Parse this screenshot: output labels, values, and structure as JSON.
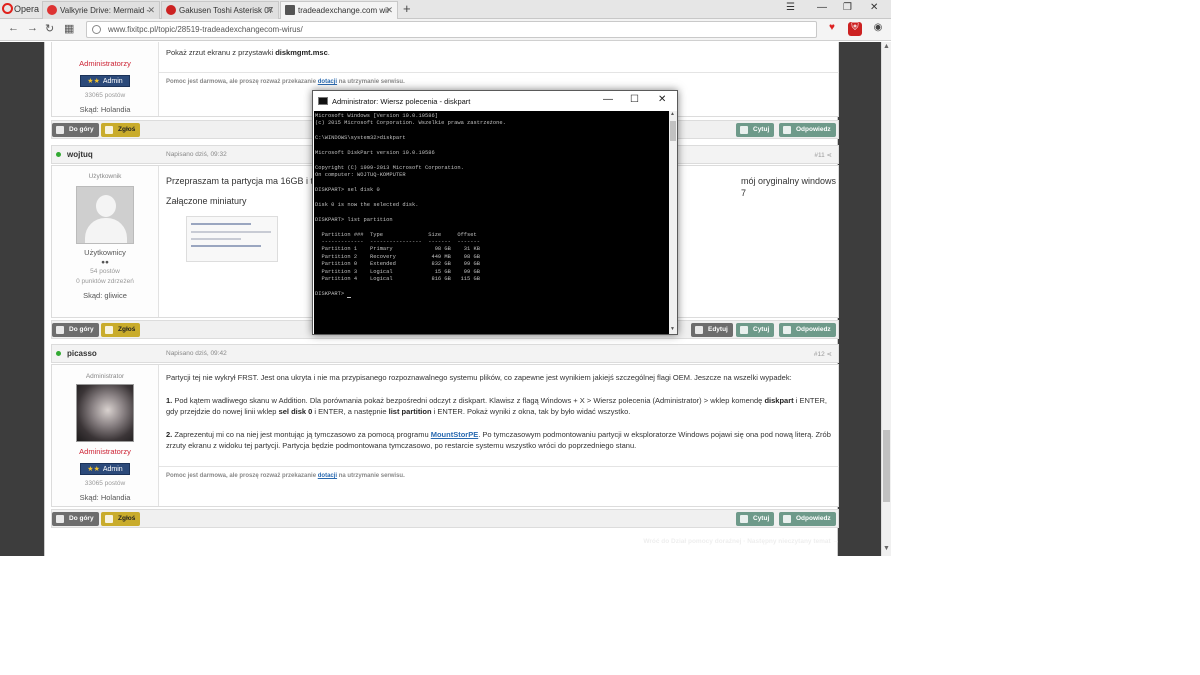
{
  "browser": {
    "menu_label": "Opera",
    "tabs": [
      {
        "title": "Valkyrie Drive: Mermaid -",
        "favicon_color": "#d33"
      },
      {
        "title": "Gakusen Toshi Asterisk 07",
        "favicon_color": "#c22"
      },
      {
        "title": "tradeadexchange.com wir",
        "favicon_color": "#555"
      }
    ],
    "new_tab_symbol": "+",
    "url": "www.fixitpc.pl/topic/28519-tradeadexchangecom-wirus/"
  },
  "post_top": {
    "group": "Administratorzy",
    "badge": "Admin",
    "badge_stars": "★★",
    "posts": "33065 postów",
    "location": "Skąd: Holandia",
    "text_prefix": "Pokaż zrzut ekranu z przystawki ",
    "text_bold": "diskmgmt.msc",
    "text_suffix": ".",
    "signature_prefix": "Pomoc jest darmowa, ale proszę rozważ przekazanie ",
    "signature_link": "dotacji",
    "signature_suffix": " na utrzymanie serwisu."
  },
  "actions": {
    "up": "Do góry",
    "report": "Zgłoś",
    "quote": "Cytuj",
    "reply": "Odpowiedz",
    "edit": "Edytuj"
  },
  "post_wojtuq": {
    "name": "wojtuq",
    "date": "Napisano dziś, 09:32",
    "number": "#11",
    "role": "Użytkownik",
    "group": "Użytkownicy",
    "stars": "●●",
    "posts": "54 postów",
    "reputation": "0 punktów zdrzeżeń",
    "location": "Skąd: gliwice",
    "text_left": "Przepraszam ta partycja ma 16GB i to",
    "text_right": "mój oryginalny windows 7",
    "attachments_label": "Załączone miniatury"
  },
  "post_picasso": {
    "name": "picasso",
    "date": "Napisano dziś, 09:42",
    "number": "#12",
    "role": "Administrator",
    "group": "Administratorzy",
    "badge": "Admin",
    "badge_stars": "★★",
    "posts": "33065 postów",
    "location": "Skąd: Holandia",
    "p1": "Partycji tej nie wykrył FRST. Jest ona ukryta i nie ma przypisanego rozpoznawalnego systemu plików, co zapewne jest wynikiem jakiejś szczególnej flagi OEM. Jeszcze na wszelki wypadek:",
    "p2_num": "1.",
    "p2_a": " Pod kątem wadliwego skanu w Addition. Dla porównania pokaż bezpośredni odczyt z diskpart. Klawisz z flagą Windows + X > Wiersz polecenia (Administrator) > wklep komendę ",
    "p2_b": "diskpart",
    "p2_c": " i ENTER, gdy przejdzie do nowej linii wklep ",
    "p2_d": "sel disk 0",
    "p2_e": " i ENTER, a następnie ",
    "p2_f": "list partition",
    "p2_g": " i ENTER. Pokaż wyniki z okna, tak by było widać wszystko.",
    "p3_num": "2.",
    "p3_a": " Zaprezentuj mi co na niej jest montując ją tymczasowo za pomocą programu ",
    "p3_link": "MountStorPE",
    "p3_b": ". Po tymczasowym podmontowaniu partycji w eksploratorze Windows pojawi się ona pod nową literą. Zrób zrzuty ekranu z widoku tej partycji. Partycja będzie podmontowana tymczasowo, po restarcie systemu wszystko wróci do poprzedniego stanu.",
    "signature_prefix": "Pomoc jest darmowa, ale proszę rozważ przekazanie ",
    "signature_link": "dotacji",
    "signature_suffix": " na utrzymanie serwisu."
  },
  "footer": {
    "back": "Wróć do Dział pomocy doraźnej",
    "sep": " · ",
    "next": "Następny nieczytany temat →"
  },
  "cmd": {
    "title": "Administrator: Wiersz polecenia - diskpart",
    "lines": [
      "Microsoft Windows [Version 10.0.10586]",
      "(c) 2015 Microsoft Corporation. Wszelkie prawa zastrzeżone.",
      "",
      "C:\\WINDOWS\\system32>diskpart",
      "",
      "Microsoft DiskPart version 10.0.10586",
      "",
      "Copyright (C) 1999-2013 Microsoft Corporation.",
      "On computer: WOJTUQ-KOMPUTER",
      "",
      "DISKPART> sel disk 0",
      "",
      "Disk 0 is now the selected disk.",
      "",
      "DISKPART> list partition",
      "",
      "  Partition ###  Type              Size     Offset",
      "  -------------  ----------------  -------  -------",
      "  Partition 1    Primary             98 GB    31 KB",
      "  Partition 2    Recovery           449 MB    98 GB",
      "  Partition 0    Extended           832 GB    99 GB",
      "  Partition 3    Logical             15 GB    99 GB",
      "  Partition 4    Logical            816 GB   115 GB",
      "",
      "DISKPART> "
    ]
  },
  "colors": {
    "page_bg": "#3d3d3d",
    "admin_badge": "#2c4a7a",
    "link": "#2a6ab0",
    "report_button": "#c9ac2c",
    "quote_button": "#6e9a8a"
  }
}
